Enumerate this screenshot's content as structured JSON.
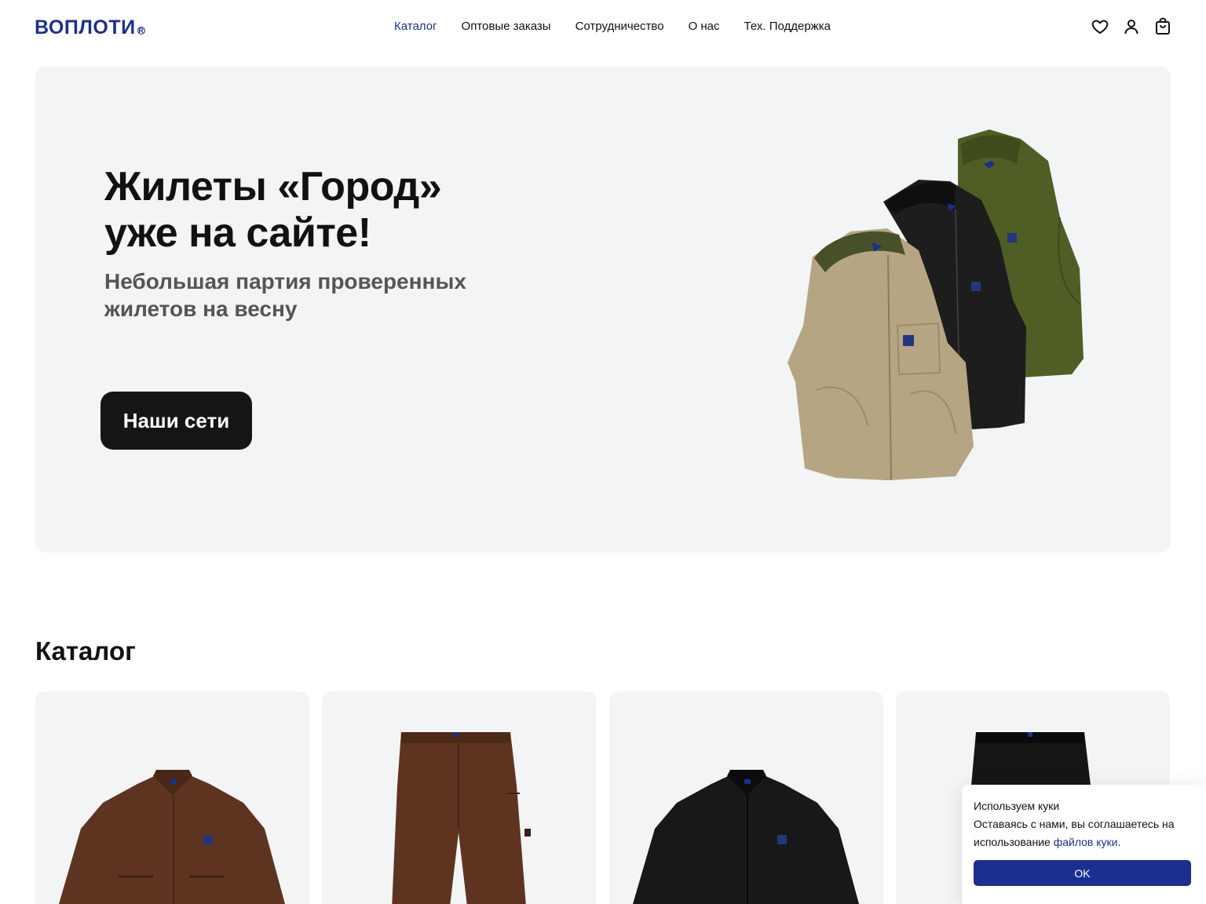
{
  "header": {
    "logo": "ВОПЛОТИ",
    "logo_mark": "R",
    "nav": [
      "Каталог",
      "Оптовые заказы",
      "Сотрудничество",
      "О нас",
      "Тех. Поддержка"
    ],
    "active_nav": "Каталог",
    "icons": [
      "heart-icon",
      "user-icon",
      "cart-icon"
    ]
  },
  "hero": {
    "title_line1": "Жилеты «Город»",
    "title_line2": "уже на сайте!",
    "subtitle_line1": "Небольшая партия проверенных",
    "subtitle_line2": "жилетов на весну",
    "button": "Наши сети"
  },
  "catalog": {
    "title": "Каталог",
    "items": [
      "brown-jacket",
      "brown-pants",
      "black-jacket",
      "black-pants"
    ]
  },
  "cookie": {
    "title": "Используем куки",
    "text_before": "Оставаясь с нами, вы соглашаетесь на использование ",
    "link": "файлов куки",
    "text_after": ".",
    "ok": "OK"
  },
  "colors": {
    "brand": "#1c2f91",
    "hero_bg": "#f3f4f6",
    "button_bg": "#151515"
  }
}
